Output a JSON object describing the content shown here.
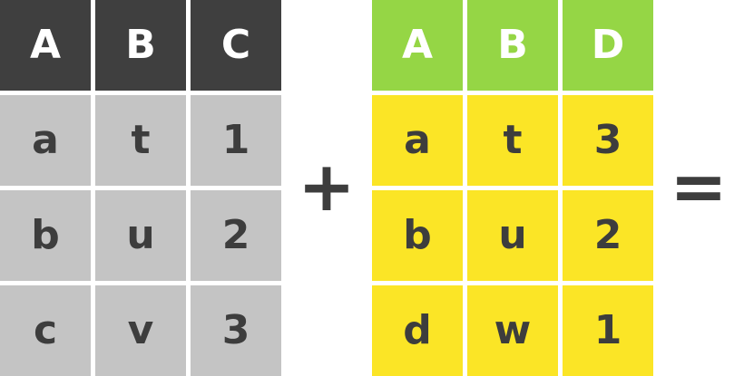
{
  "left_table": {
    "headers": [
      "A",
      "B",
      "C"
    ],
    "rows": [
      [
        "a",
        "t",
        "1"
      ],
      [
        "b",
        "u",
        "2"
      ],
      [
        "c",
        "v",
        "3"
      ]
    ]
  },
  "right_table": {
    "headers": [
      "A",
      "B",
      "D"
    ],
    "rows": [
      [
        "a",
        "t",
        "3"
      ],
      [
        "b",
        "u",
        "2"
      ],
      [
        "d",
        "w",
        "1"
      ]
    ]
  },
  "operators": {
    "plus": "+",
    "equals": "="
  },
  "colors": {
    "left_header": "#3f3f3f",
    "left_body": "#c4c4c4",
    "right_header": "#95d645",
    "right_body": "#fbe526",
    "text_dark": "#3d3d3d"
  }
}
